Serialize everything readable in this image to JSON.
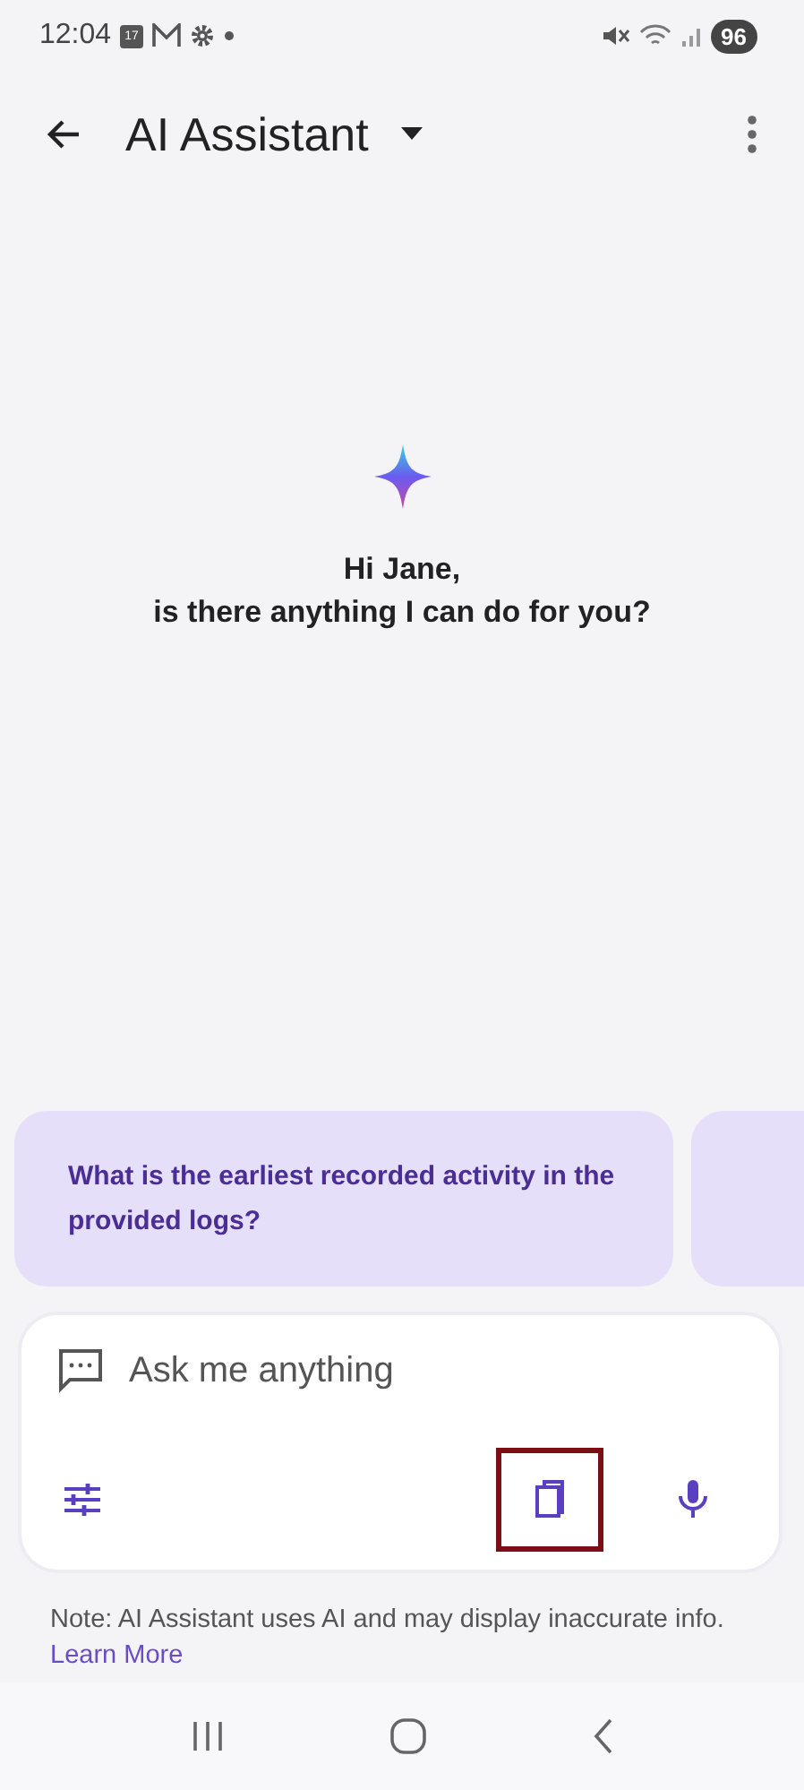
{
  "status_bar": {
    "time": "12:04",
    "calendar_day": "17",
    "battery": "96"
  },
  "app_bar": {
    "title": "AI Assistant"
  },
  "greeting": {
    "lines": [
      "Hi Jane,",
      "is there anything I can do for you?"
    ]
  },
  "suggestions": [
    {
      "text": "What is the earliest recorded activity in the provided logs?"
    }
  ],
  "input": {
    "placeholder": "Ask me anything"
  },
  "tools": [
    {
      "kind": "settings",
      "highlighted": false
    },
    {
      "kind": "book",
      "highlighted": true
    },
    {
      "kind": "mic",
      "highlighted": false
    }
  ],
  "note": {
    "text": "Note: AI Assistant uses AI and may display inaccurate info.",
    "link": "Learn More"
  }
}
